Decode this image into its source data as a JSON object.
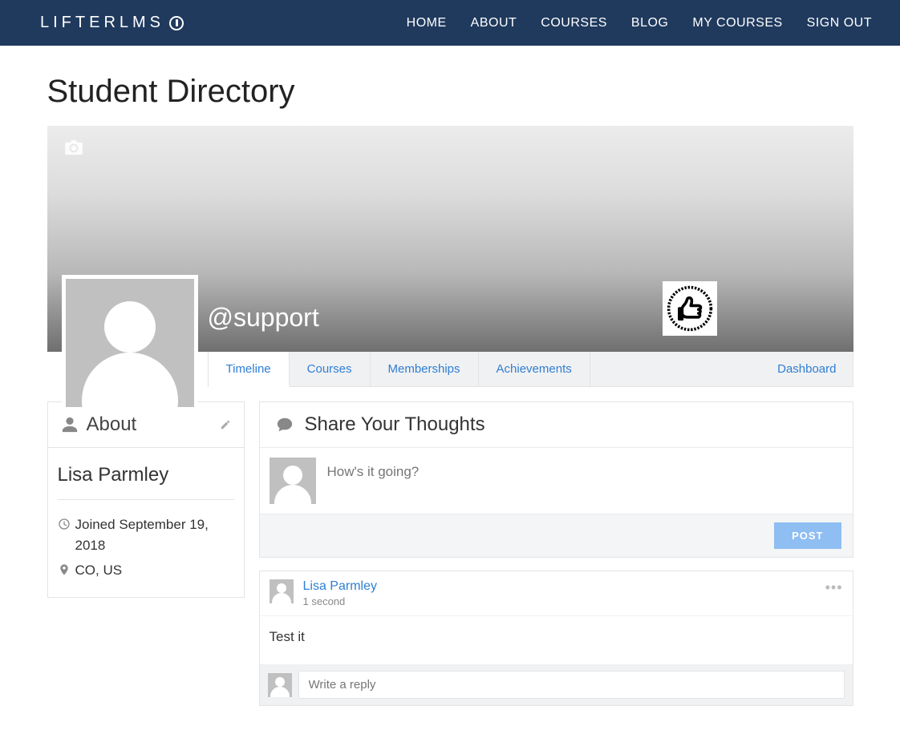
{
  "logo": "LIFTERLMS",
  "nav": {
    "home": "HOME",
    "about": "ABOUT",
    "courses": "COURSES",
    "blog": "BLOG",
    "my_courses": "MY COURSES",
    "sign_out": "SIGN OUT"
  },
  "page_title": "Student Directory",
  "profile": {
    "handle": "@support"
  },
  "tabs": {
    "timeline": "Timeline",
    "courses": "Courses",
    "memberships": "Memberships",
    "achievements": "Achievements",
    "dashboard": "Dashboard"
  },
  "about_card": {
    "title": "About",
    "name": "Lisa Parmley",
    "joined_label": "Joined September 19, 2018",
    "location": "CO, US"
  },
  "share": {
    "title": "Share Your Thoughts",
    "placeholder": "How's it going?",
    "post_label": "POST"
  },
  "posts": [
    {
      "author": "Lisa Parmley",
      "time": "1 second",
      "content": "Test it",
      "reply_placeholder": "Write a reply"
    }
  ]
}
